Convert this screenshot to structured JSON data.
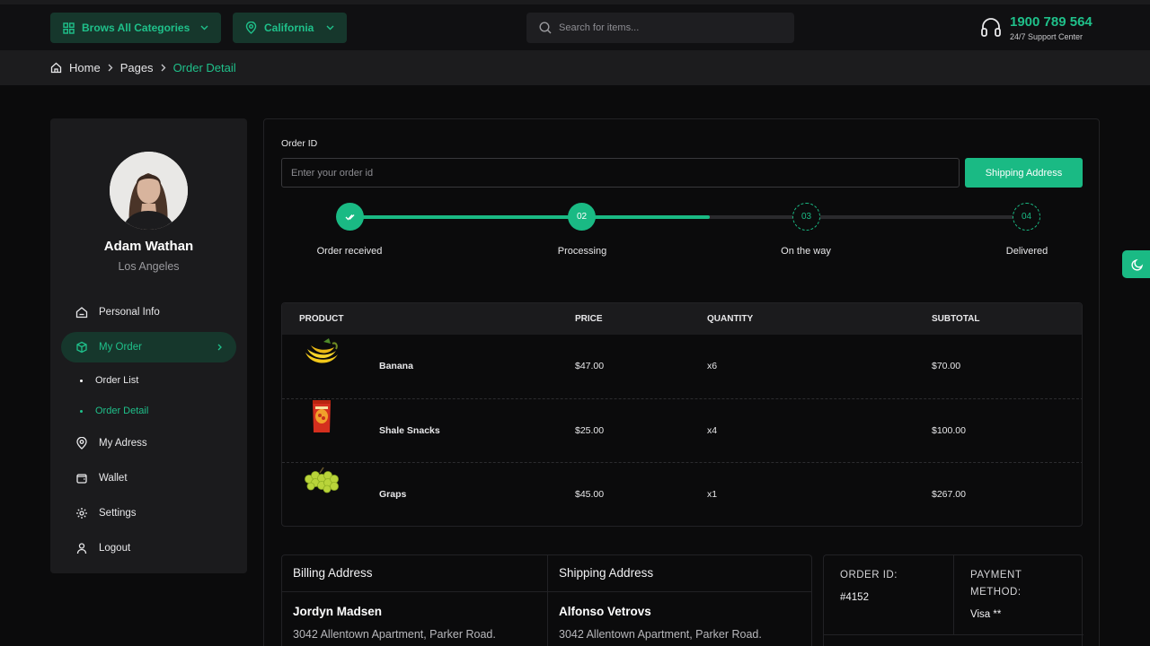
{
  "header": {
    "categories_label": "Brows All Categories",
    "location_label": "California",
    "search_placeholder": "Search for items...",
    "support_phone": "1900 789 564",
    "support_caption": "24/7 Support Center"
  },
  "breadcrumb": {
    "items": [
      "Home",
      "Pages",
      "Order Detail"
    ]
  },
  "profile": {
    "name": "Adam Wathan",
    "location": "Los Angeles"
  },
  "sidebar": {
    "items": [
      {
        "label": "Personal Info",
        "icon": "home-icon"
      },
      {
        "label": "My Order",
        "icon": "box-icon"
      },
      {
        "label": "Order List"
      },
      {
        "label": "Order Detail"
      },
      {
        "label": "My Adress",
        "icon": "map-pin-icon"
      },
      {
        "label": "Wallet",
        "icon": "wallet-icon"
      },
      {
        "label": "Settings",
        "icon": "gear-icon"
      },
      {
        "label": "Logout",
        "icon": "user-icon"
      }
    ]
  },
  "order": {
    "id_label": "Order ID",
    "id_placeholder": "Enter your order id",
    "button_label": "Shipping Address"
  },
  "tracker": {
    "steps": [
      {
        "number": "",
        "label": "Order received",
        "status": "done"
      },
      {
        "number": "02",
        "label": "Processing",
        "status": "done"
      },
      {
        "number": "03",
        "label": "On the way",
        "status": "pending"
      },
      {
        "number": "04",
        "label": "Delivered",
        "status": "pending"
      }
    ],
    "progress_fraction": 0.54
  },
  "table": {
    "headers": [
      "PRODUCT",
      "PRICE",
      "QUANTITY",
      "SUBTOTAL"
    ],
    "rows": [
      {
        "name": "Banana",
        "price": "$47.00",
        "quantity": "x6",
        "subtotal": "$70.00"
      },
      {
        "name": "Shale Snacks",
        "price": "$25.00",
        "quantity": "x4",
        "subtotal": "$100.00"
      },
      {
        "name": "Graps",
        "price": "$45.00",
        "quantity": "x1",
        "subtotal": "$267.00"
      }
    ]
  },
  "billing": {
    "title": "Billing Address",
    "name": "Jordyn Madsen",
    "line1": "3042 Allentown Apartment, Parker Road."
  },
  "shipping": {
    "title": "Shipping Address",
    "name": "Alfonso Vetrovs",
    "line1": "3042 Allentown Apartment, Parker Road."
  },
  "summary": {
    "order_id_label": "ORDER ID:",
    "order_id_value": "#4152",
    "payment_label_1": "PAYMENT",
    "payment_label_2": "METHOD:",
    "payment_value": "Visa **"
  },
  "colors": {
    "accent": "#1aba84",
    "background": "#0b0b0c",
    "panel": "#1b1b1d"
  }
}
